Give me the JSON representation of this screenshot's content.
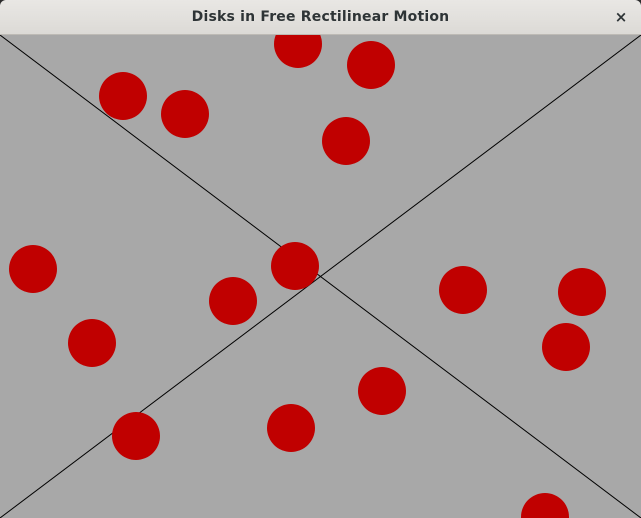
{
  "window": {
    "title": "Disks in Free Rectilinear Motion",
    "close_glyph": "×",
    "close_icon": "close-icon"
  },
  "colors": {
    "canvas_background": "#a8a8a8",
    "disk_fill": "#c00000",
    "line_stroke": "#000000"
  }
}
